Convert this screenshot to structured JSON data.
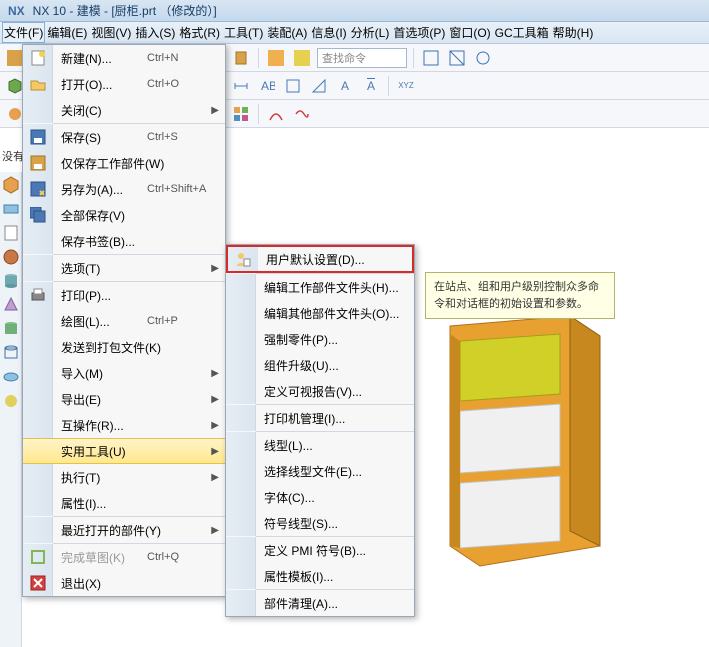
{
  "window": {
    "logo": "NX",
    "title": "NX 10 - 建模 - [厨柜.prt （修改的）]"
  },
  "menubar": [
    "文件(F)",
    "编辑(E)",
    "视图(V)",
    "插入(S)",
    "格式(R)",
    "工具(T)",
    "装配(A)",
    "信息(I)",
    "分析(L)",
    "首选项(P)",
    "窗口(O)",
    "GC工具箱",
    "帮助(H)"
  ],
  "search_placeholder": "查找命令",
  "left_label": "没有",
  "file_menu": [
    {
      "label": "新建(N)...",
      "shortcut": "Ctrl+N",
      "icon": "new"
    },
    {
      "label": "打开(O)...",
      "shortcut": "Ctrl+O",
      "icon": "open"
    },
    {
      "label": "关闭(C)",
      "arrow": true
    },
    {
      "sep": true
    },
    {
      "label": "保存(S)",
      "shortcut": "Ctrl+S",
      "icon": "save"
    },
    {
      "label": "仅保存工作部件(W)",
      "icon": "save2"
    },
    {
      "label": "另存为(A)...",
      "shortcut": "Ctrl+Shift+A",
      "icon": "saveas"
    },
    {
      "label": "全部保存(V)",
      "icon": "saveall"
    },
    {
      "label": "保存书签(B)..."
    },
    {
      "sep": true
    },
    {
      "label": "选项(T)",
      "arrow": true
    },
    {
      "sep": true
    },
    {
      "label": "打印(P)...",
      "icon": "print"
    },
    {
      "label": "绘图(L)...",
      "shortcut": "Ctrl+P"
    },
    {
      "label": "发送到打包文件(K)"
    },
    {
      "label": "导入(M)",
      "arrow": true
    },
    {
      "label": "导出(E)",
      "arrow": true
    },
    {
      "label": "互操作(R)...",
      "arrow": true
    },
    {
      "label": "实用工具(U)",
      "arrow": true,
      "highlight": true
    },
    {
      "label": "执行(T)",
      "arrow": true
    },
    {
      "label": "属性(I)..."
    },
    {
      "sep": true
    },
    {
      "label": "最近打开的部件(Y)",
      "arrow": true
    },
    {
      "sep": true
    },
    {
      "label": "完成草图(K)",
      "shortcut": "Ctrl+Q",
      "icon": "sketch",
      "disabled": true
    },
    {
      "label": "退出(X)",
      "icon": "exit"
    }
  ],
  "util_submenu": [
    {
      "label": "用户默认设置(D)...",
      "icon": "usersettings",
      "selected": true
    },
    {
      "sep": true
    },
    {
      "label": "编辑工作部件文件头(H)..."
    },
    {
      "label": "编辑其他部件文件头(O)..."
    },
    {
      "label": "强制零件(P)..."
    },
    {
      "label": "组件升级(U)..."
    },
    {
      "label": "定义可视报告(V)..."
    },
    {
      "sep": true
    },
    {
      "label": "打印机管理(I)..."
    },
    {
      "sep": true
    },
    {
      "label": "线型(L)..."
    },
    {
      "label": "选择线型文件(E)..."
    },
    {
      "label": "字体(C)..."
    },
    {
      "label": "符号线型(S)..."
    },
    {
      "sep": true
    },
    {
      "label": "定义 PMI 符号(B)..."
    },
    {
      "label": "属性模板(I)..."
    },
    {
      "sep": true
    },
    {
      "label": "部件清理(A)..."
    }
  ],
  "tooltip": "在站点、组和用户级别控制众多命令和对话框的初始设置和参数。"
}
